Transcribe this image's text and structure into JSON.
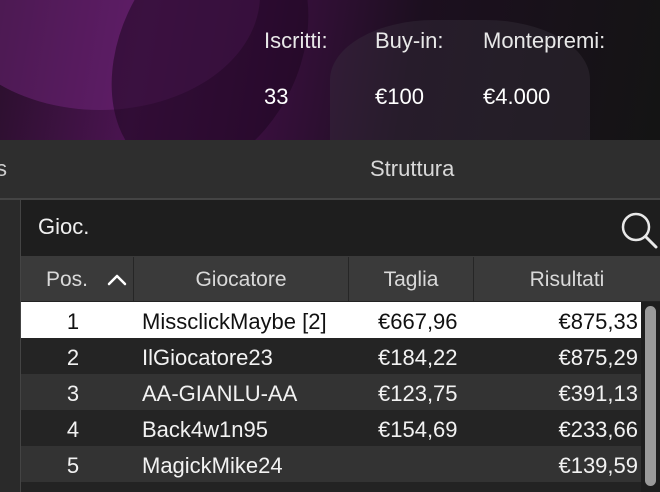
{
  "tournament": {
    "entrants_label": "Iscritti:",
    "entrants_value": "33",
    "buyin_label": "Buy-in:",
    "buyin_value": "€100",
    "prize_label": "Montepremi:",
    "prize_value": "€4.000"
  },
  "tabs": {
    "previous_partial": "s",
    "active": "Struttura"
  },
  "search": {
    "value": "Gioc.",
    "icon": "search-icon"
  },
  "table": {
    "headers": {
      "pos": "Pos.",
      "player": "Giocatore",
      "stack": "Taglia",
      "result": "Risultati"
    },
    "sort_icon": "chevron-up-icon",
    "rows": [
      {
        "pos": "1",
        "player": "MissclickMaybe [2]",
        "stack": "€667,96",
        "result": "€875,33"
      },
      {
        "pos": "2",
        "player": "IlGiocatore23",
        "stack": "€184,22",
        "result": "€875,29"
      },
      {
        "pos": "3",
        "player": "AA-GIANLU-AA",
        "stack": "€123,75",
        "result": "€391,13"
      },
      {
        "pos": "4",
        "player": "Back4w1n95",
        "stack": "€154,69",
        "result": "€233,66"
      },
      {
        "pos": "5",
        "player": "MagickMike24",
        "stack": "",
        "result": "€139,59"
      }
    ]
  },
  "colors": {
    "accent": "#4a1450",
    "selected_row": "#ffffff"
  }
}
